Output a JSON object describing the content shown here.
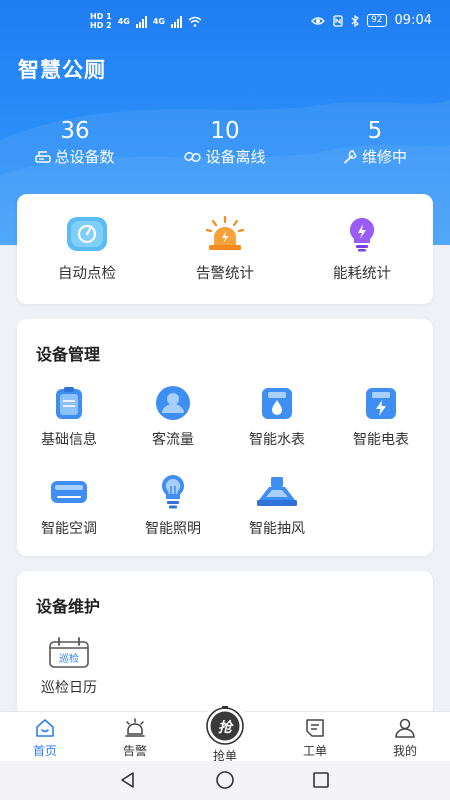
{
  "status_bar": {
    "hd1": "HD 1",
    "hd2": "HD 2",
    "net1": "4G",
    "net2": "4G",
    "battery": "92",
    "time": "09:04"
  },
  "header": {
    "title": "智慧公厕"
  },
  "stats": [
    {
      "value": "36",
      "label": "总设备数",
      "icon": "device-icon"
    },
    {
      "value": "10",
      "label": "设备离线",
      "icon": "offline-link-icon"
    },
    {
      "value": "5",
      "label": "维修中",
      "icon": "wrench-icon"
    }
  ],
  "quick_actions": [
    {
      "label": "自动点检",
      "icon": "gauge-icon"
    },
    {
      "label": "告警统计",
      "icon": "alarm-light-icon"
    },
    {
      "label": "能耗统计",
      "icon": "bulb-energy-icon"
    }
  ],
  "device_management": {
    "title": "设备管理",
    "items": [
      {
        "label": "基础信息",
        "icon": "clipboard-icon"
      },
      {
        "label": "客流量",
        "icon": "person-icon"
      },
      {
        "label": "智能水表",
        "icon": "water-meter-icon"
      },
      {
        "label": "智能电表",
        "icon": "electric-meter-icon"
      },
      {
        "label": "智能空调",
        "icon": "air-conditioner-icon"
      },
      {
        "label": "智能照明",
        "icon": "light-bulb-icon"
      },
      {
        "label": "智能抽风",
        "icon": "range-hood-icon"
      }
    ]
  },
  "device_maintenance": {
    "title": "设备维护",
    "items": [
      {
        "label": "巡检日历",
        "icon": "calendar-icon",
        "badge": "巡检"
      }
    ]
  },
  "tabbar": {
    "items": [
      {
        "label": "首页",
        "icon": "home-icon",
        "active": true
      },
      {
        "label": "告警",
        "icon": "bell-alarm-icon",
        "active": false
      },
      {
        "label": "抢单",
        "icon": "grab-order-icon",
        "glyph": "抢",
        "active": false
      },
      {
        "label": "工单",
        "icon": "work-order-icon",
        "active": false
      },
      {
        "label": "我的",
        "icon": "user-icon",
        "active": false
      }
    ]
  },
  "colors": {
    "primary": "#2b7ff1",
    "hero_top": "#1f7df2",
    "hero_bottom": "#3a9bf9",
    "icon_blue": "#3f8ef4",
    "alarm_orange": "#f28a1e",
    "energy_purple": "#8f52f2"
  }
}
